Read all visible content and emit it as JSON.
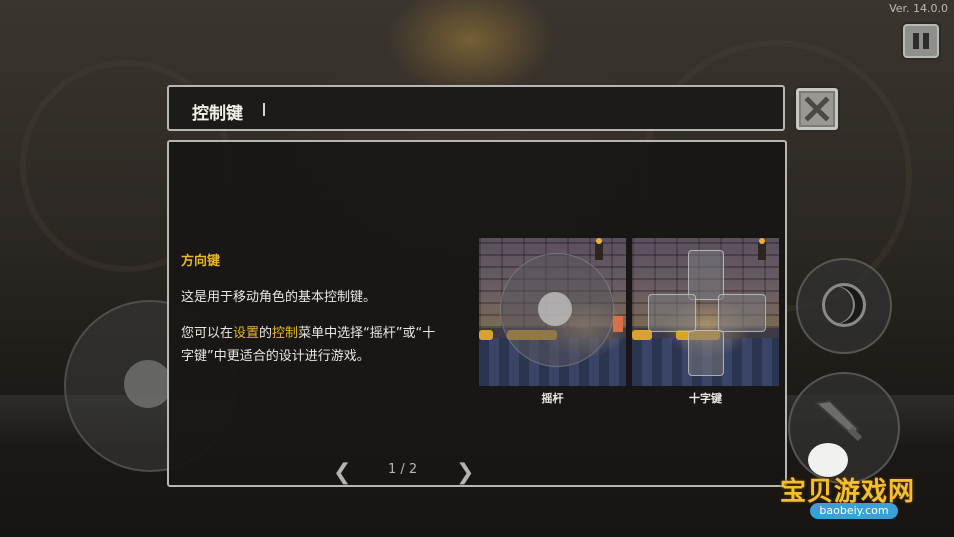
{
  "version": "Ver. 14.0.0",
  "dialog": {
    "title": "控制键",
    "section_heading": "方向键",
    "line1": "这是用于移动角色的基本控制键。",
    "line2_part1": "您可以在",
    "line2_highlight1": "设置",
    "line2_part2": "的",
    "line2_highlight2": "控制",
    "line2_part3": "菜单中选择“摇杆”或“十",
    "line3": "字键”中更适合的设计进行游戏。",
    "preview_left_label": "摇杆",
    "preview_right_label": "十字键",
    "page_indicator": "1 / 2",
    "prev_arrow": "❮",
    "next_arrow": "❯"
  },
  "icons": {
    "pause": "pause-icon",
    "close": "close-icon",
    "moon": "moon-icon",
    "sword": "sword-icon"
  },
  "watermark": {
    "title": "宝贝游戏网",
    "url": "baobeiy.com"
  },
  "colors": {
    "highlight": "#e8b62a",
    "panel_border": "#b8b6b0",
    "panel_bg": "#1c1b19"
  }
}
